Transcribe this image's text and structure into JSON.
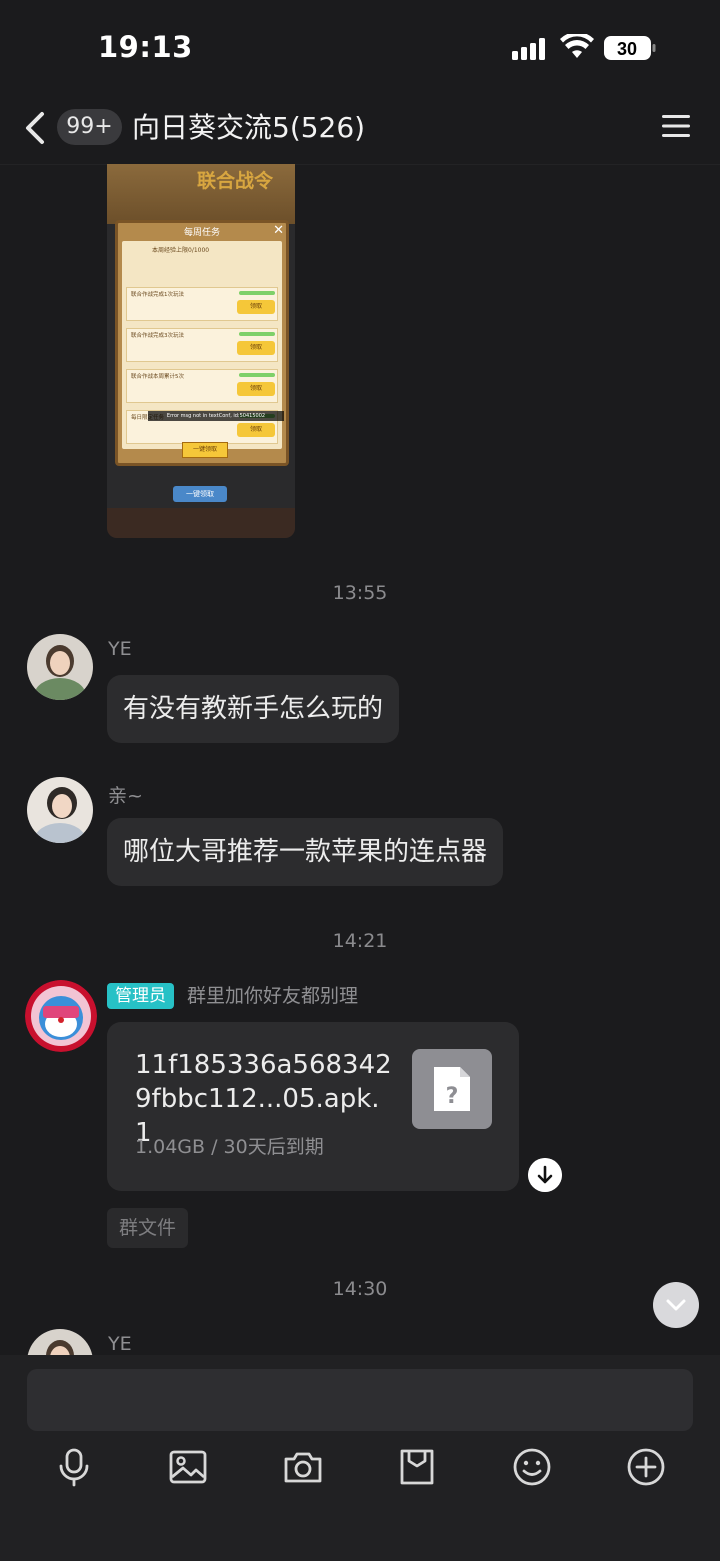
{
  "status_bar": {
    "time": "19:13",
    "battery": "30"
  },
  "header": {
    "unread_badge": "99+",
    "title": "向日葵交流5(526)"
  },
  "shared_image": {
    "banner": "联合战令",
    "modal_title": "每周任务",
    "progress_text": "本周经验上限0/1000",
    "rows": [
      {
        "label": "联合作战完成1次玩法",
        "claim": "领取"
      },
      {
        "label": "联合作战完成3次玩法",
        "claim": "领取"
      },
      {
        "label": "联合作战本周累计5次",
        "claim": "领取"
      },
      {
        "label": "每日限定任务",
        "claim": "领取"
      }
    ],
    "error_text": "Error msg not in textConf, id:50415002",
    "claim_all": "一键领取",
    "bottom_button": "一键领取"
  },
  "messages": {
    "ts1": "13:55",
    "msg1": {
      "sender": "YE",
      "text": "有没有教新手怎么玩的"
    },
    "msg2": {
      "sender": "亲~",
      "text": "哪位大哥推荐一款苹果的连点器"
    },
    "ts2": "14:21",
    "msg3": {
      "badge": "管理员",
      "sender": "群里加你好友都别理",
      "file_name": "11f185336a5683429fbbc112...05.apk.1",
      "file_meta": "1.04GB / 30天后到期",
      "file_icon_glyph": "?",
      "tag": "群文件"
    },
    "ts3": "14:30",
    "msg4": {
      "sender": "YE"
    }
  },
  "input": {
    "placeholder": ""
  },
  "icons": {
    "toolbar": [
      "microphone-icon",
      "image-icon",
      "camera-icon",
      "folder-icon",
      "emoji-icon",
      "plus-icon"
    ]
  },
  "colors": {
    "background": "#1b1b1d",
    "bubble": "#2c2c2e",
    "admin_badge": "#27c1c6"
  }
}
